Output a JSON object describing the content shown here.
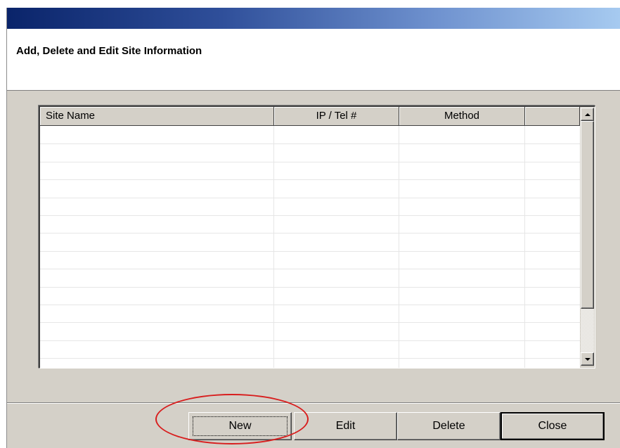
{
  "dialog": {
    "header_title": "Add, Delete and Edit Site Information"
  },
  "site_list": {
    "columns": [
      {
        "label": "Site Name"
      },
      {
        "label": "IP / Tel #"
      },
      {
        "label": "Method"
      },
      {
        "label": ""
      }
    ],
    "rows": []
  },
  "buttons": {
    "new_label": "New",
    "edit_label": "Edit",
    "delete_label": "Delete",
    "close_label": "Close"
  },
  "colors": {
    "annotation": "#d81e1e",
    "title_bar_start": "#0a246a",
    "title_bar_end": "#a6caf0",
    "dialog_face": "#d4d0c8"
  }
}
